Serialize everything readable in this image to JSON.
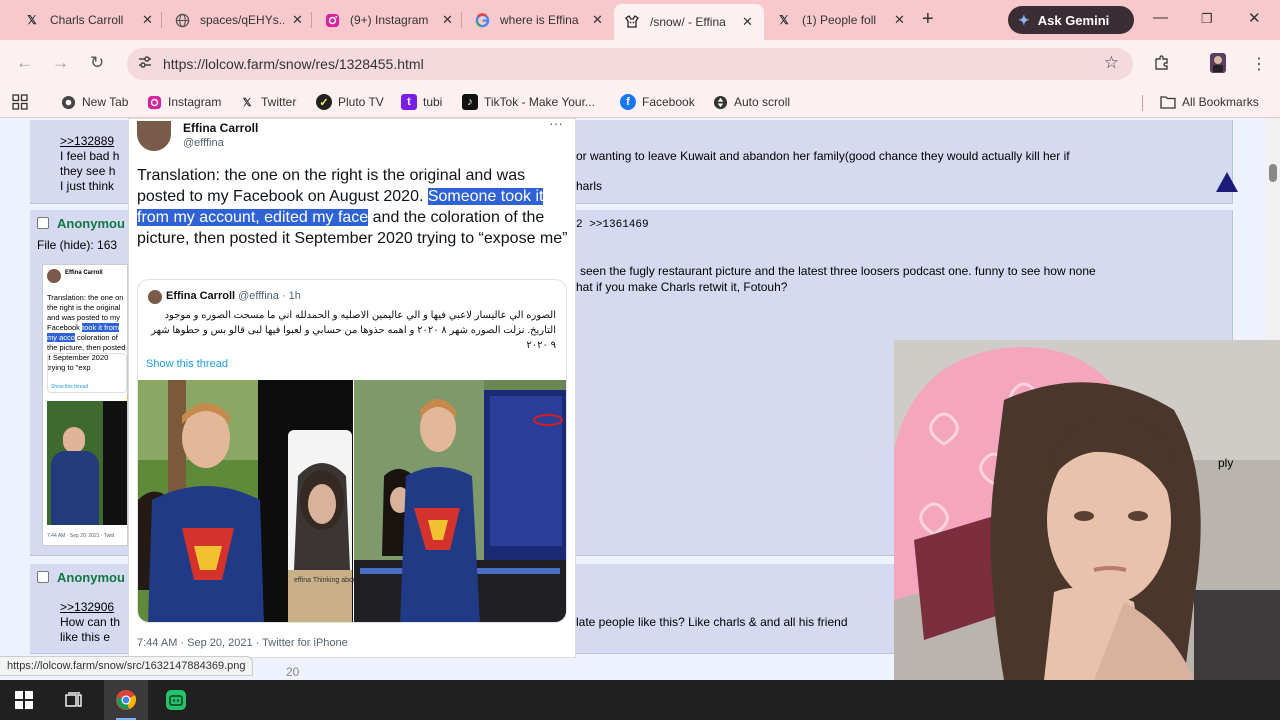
{
  "tabs": [
    {
      "label": "Charls Carroll",
      "icon": "x-logo-icon",
      "close": "✕"
    },
    {
      "label": "spaces/qEHYs...",
      "icon": "globe-icon",
      "close": "✕"
    },
    {
      "label": "(9+) Instagram",
      "icon": "instagram-icon",
      "close": "✕"
    },
    {
      "label": "where is Effina",
      "icon": "google-icon",
      "close": "✕"
    },
    {
      "label": "/snow/ - Effina",
      "icon": "lolcow-icon",
      "close": "✕",
      "active": true
    },
    {
      "label": "(1) People foll",
      "icon": "x-logo-icon",
      "close": "✕"
    }
  ],
  "gemini_label": "Ask Gemini",
  "url": "https://lolcow.farm/snow/res/1328455.html",
  "bookmarks": [
    {
      "label": "New Tab",
      "icon": "chrome-icon"
    },
    {
      "label": "Instagram",
      "icon": "instagram-icon"
    },
    {
      "label": "Twitter",
      "icon": "x-logo-icon"
    },
    {
      "label": "Pluto TV",
      "icon": "pluto-tv-icon"
    },
    {
      "label": "tubi",
      "icon": "tubi-icon"
    },
    {
      "label": "TikTok - Make Your...",
      "icon": "tiktok-icon"
    },
    {
      "label": "Facebook",
      "icon": "facebook-icon"
    },
    {
      "label": "Auto scroll",
      "icon": "auto-scroll-icon"
    }
  ],
  "all_bookmarks_label": "All Bookmarks",
  "posts": {
    "p1_link": ">>132889",
    "p1_line1": "I feel bad h",
    "p1_line2": "they see h",
    "p1_line3": "I just think",
    "p1_right1": "or wanting to leave Kuwait and abandon her family(good chance they would actually kill her if",
    "p1_right2": "harls",
    "p2_name": "Anonymou",
    "p2_file_prefix": "File (",
    "p2_hide": "hide",
    "p2_file_suffix": "): 163",
    "p2_backlinks": "2 >>1361469",
    "p2_right1": "seen the fugly restaurant picture and the latest three loosers podcast one. funny to see how none",
    "p2_right2": "hat if you make Charls retwit it, Fotouh?",
    "p3_name": "Anonymou",
    "p3_link": ">>132906",
    "p3_line1": "How can th",
    "p3_line2": "like this e",
    "p3_right": "late people like this? Like charls & and all his friend",
    "p3_reply": "ply",
    "footer_fragment": "20"
  },
  "card": {
    "name": "Effina Carroll",
    "handle": "@efffina",
    "more": "···",
    "tweet_before": "Translation: the one on the right is the original and was posted to my Facebook on August 2020. ",
    "tweet_highlight": "Someone took it from my account, edited my face",
    "tweet_after": " and the coloration of the picture, then posted it September 2020 trying to “expose me”",
    "quote_name": "Effina Carroll",
    "quote_meta": " @efffina · 1h",
    "quote_arabic": "الصوره الي عاليسار لاعبي فيها و الي عاليمين الاصليه و الحمدلله اني ما مسحت الصوره و موجود التاريخ. نزلت الصوره شهر ٨ ٢٠٢٠ و اهمه حذوها من حسابي و لعبوا فيها لبى قالو بس و حطوها شهر ٩ ٢٠٢٠",
    "show_thread": "Show this thread",
    "footer": "7:44 AM · Sep 20, 2021 · Twitter for iPhone"
  },
  "thumb": {
    "name": "Effina Carroll",
    "text": "Translation: the one on the right is the original and was posted to my Facebook",
    "highlight": "took it from my acco",
    "tail": "coloration of the picture, then posted it September 2020 trying to \"exp",
    "show": "Show this thread",
    "foot": "7:44 AM · Sep 20, 2021 · Twitt"
  },
  "phone_caption": "effina Thinking about Fotouh",
  "status_url": "https://lolcow.farm/snow/src/1632147884369.png",
  "colors": {
    "tab_strip": "#f7c9cd",
    "toolbar": "#fdf0f1",
    "page_bg": "#eef2ff",
    "post_bg": "#d6daf0",
    "anon_name": "#117743",
    "highlight": "#2f63d5",
    "taskbar": "#202020"
  }
}
